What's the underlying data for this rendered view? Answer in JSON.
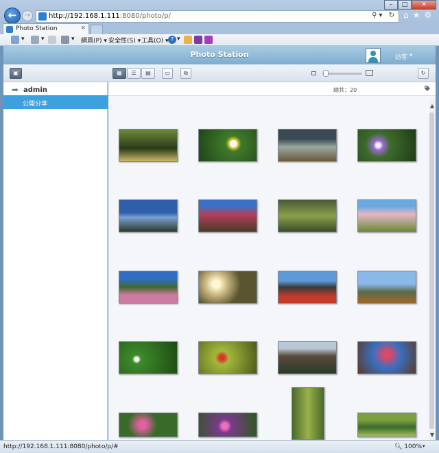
{
  "browser": {
    "url_host": "http://192.168.1.111",
    "url_path": ":8080/photo/p/",
    "tab_title": "Photo Station",
    "tab_close": "×",
    "back_glyph": "←",
    "forward_glyph": "→",
    "address_tools": "⚲▾ ↻",
    "right_icons": [
      "⌂",
      "★",
      "⚙"
    ],
    "window_controls": {
      "minimize": "–",
      "maximize": "□",
      "close": "✕"
    },
    "command_bar": {
      "page_menu": "網頁(P)",
      "safety_menu": "安全性(S)",
      "tools_menu": "工具(O)",
      "help_menu": "?"
    },
    "status_url": "http://192.168.1.111:8080/photo/p/#",
    "zoom": "100%"
  },
  "app": {
    "title": "Photo Station",
    "user_label": "訪客",
    "user_chevron": "▾",
    "toolbar": {
      "view_thumbnail_glyph": "▦",
      "view_list_glyph": "☰",
      "view_detail_glyph": "▤",
      "refresh_glyph": "↻"
    },
    "sidebar": {
      "user_name": "admin",
      "user_arrow": "➦",
      "items": [
        {
          "label": "公開分享",
          "selected": true
        }
      ]
    },
    "content": {
      "total_label": "總共：20",
      "photo_count": 20,
      "scroll_up": "▲",
      "scroll_down": "▼"
    },
    "colors": {
      "header": "#8fbad9",
      "selected_item": "#3ca1dd",
      "content_bg": "#f4f6f9"
    }
  }
}
